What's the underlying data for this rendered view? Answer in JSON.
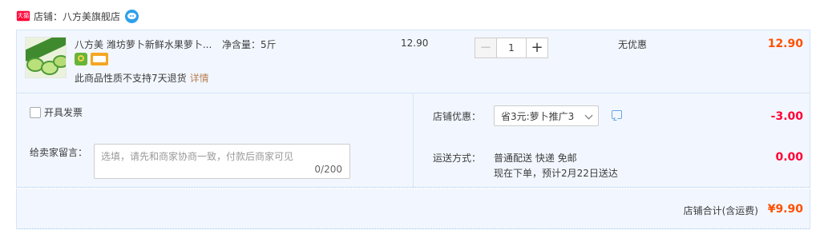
{
  "shop": {
    "badge": "天猫",
    "label": "店铺：八方美旗舰店",
    "chat_icon": "wangwang-chat-icon"
  },
  "item": {
    "title": "八方美 潍坊萝卜新鲜水果萝卜...",
    "sku": "净含量：5斤",
    "unit_price": "12.90",
    "quantity": "1",
    "minus": "−",
    "plus": "+",
    "discount": "无优惠",
    "total": "12.90",
    "return_note": "此商品性质不支持7天退货",
    "detail_link": "详情"
  },
  "order": {
    "invoice_label": "开具发票",
    "message_label": "给卖家留言：",
    "message_placeholder": "选填，请先和商家协商一致，付款后商家可见",
    "message_count": "0/200",
    "promo_label": "店铺优惠：",
    "promo_value": "省3元:萝卜推广3",
    "promo_amount": "-3.00",
    "shipping_label": "运送方式：",
    "shipping_method": "普通配送 快递 免邮",
    "shipping_eta": "现在下单，预计2月22日送达",
    "shipping_fee": "0.00"
  },
  "totals": {
    "label": "店铺合计(含运费)",
    "amount": "¥9.90"
  },
  "colors": {
    "price_orange": "#ff5000",
    "discount_red": "#ff0036",
    "panel_blue": "#f2f7ff",
    "link_brown": "#b98055"
  }
}
